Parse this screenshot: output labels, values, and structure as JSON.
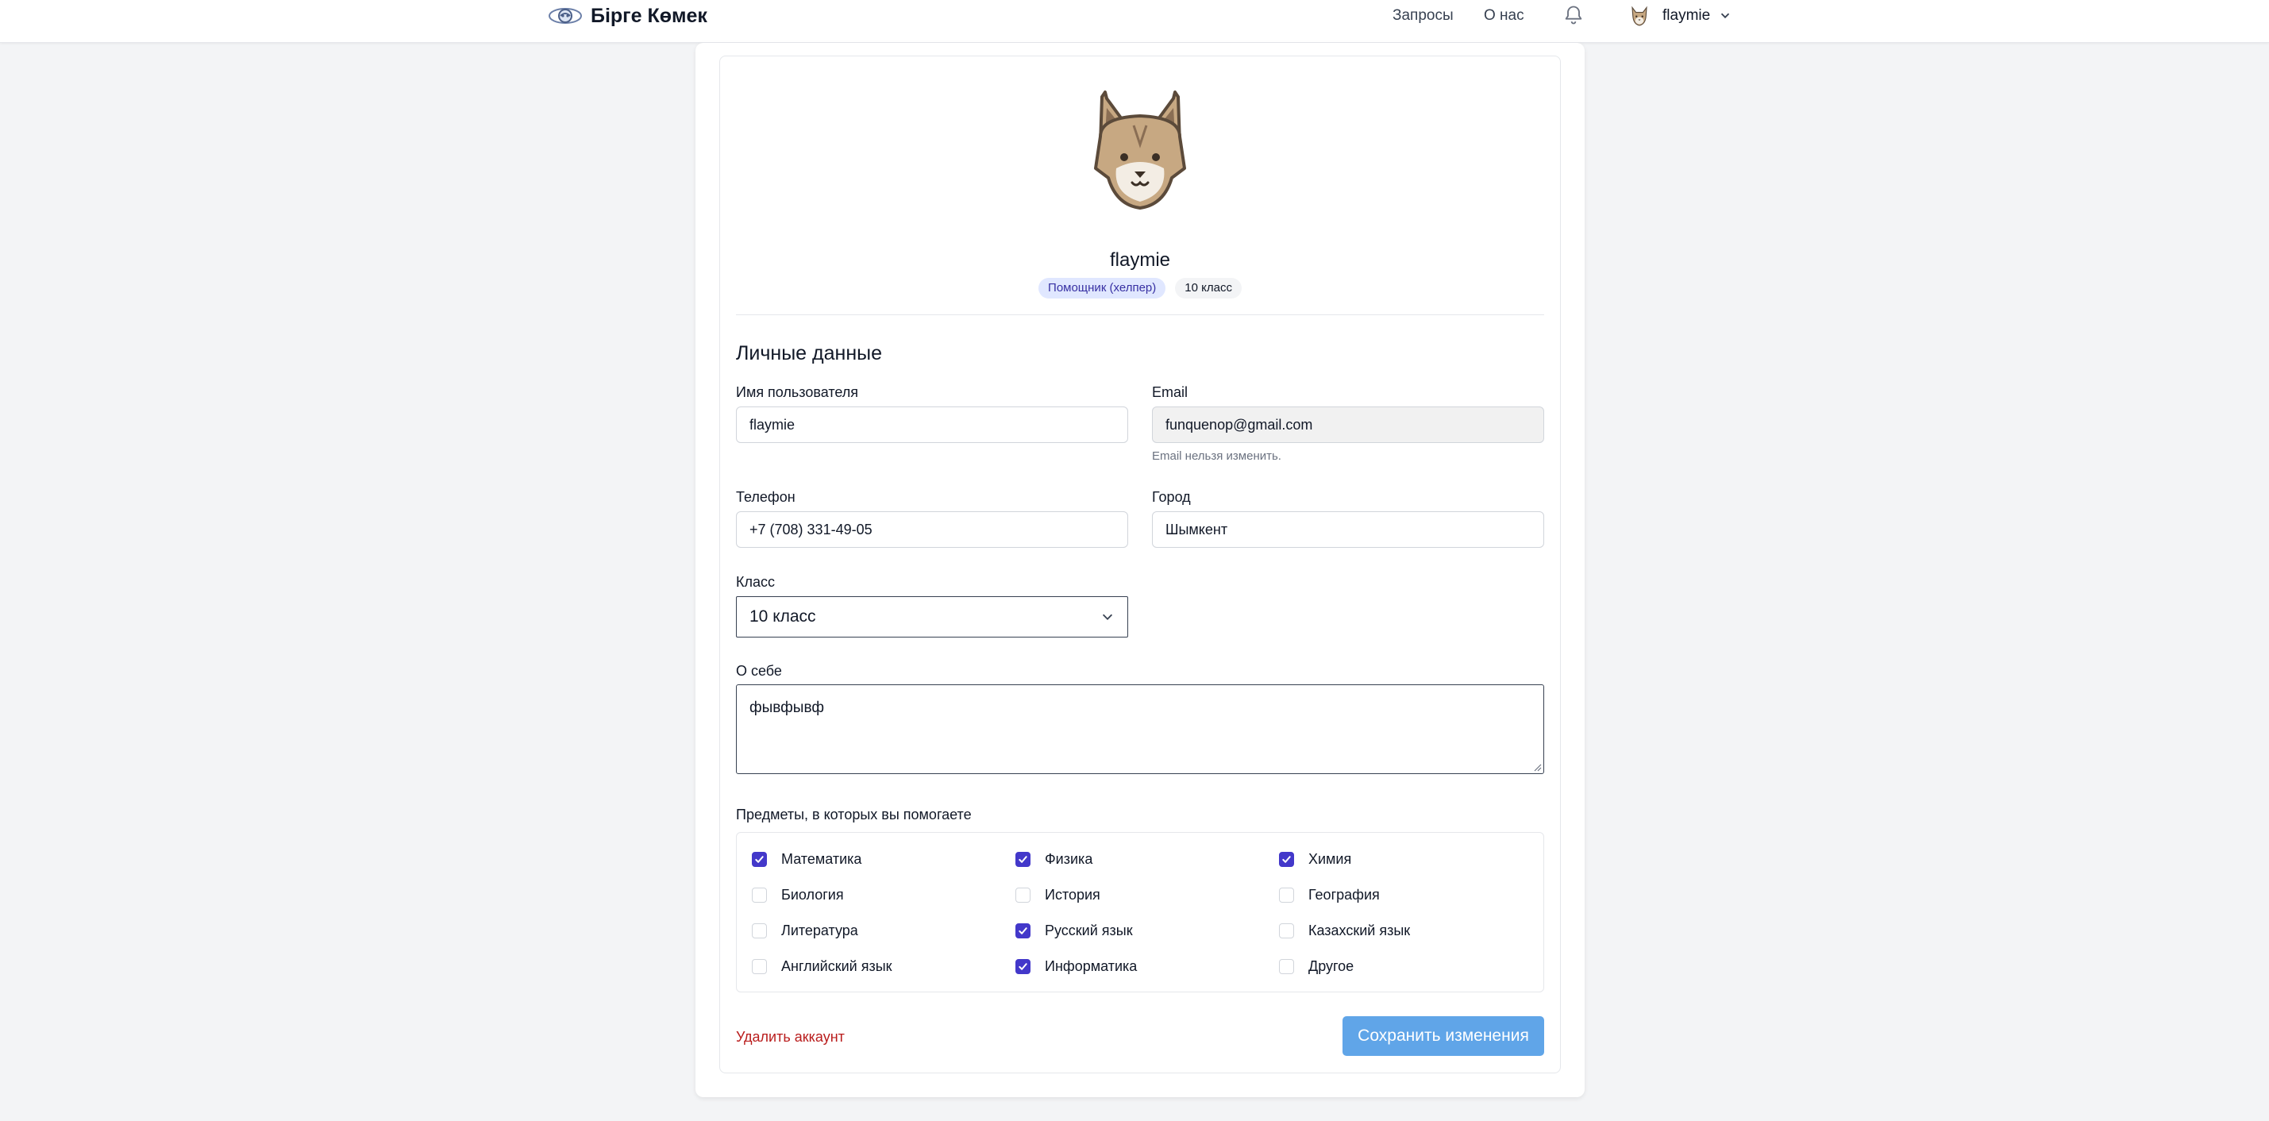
{
  "header": {
    "brand": "Бірге Көмек",
    "nav": {
      "requests": "Запросы",
      "about": "О нас"
    },
    "user": {
      "name": "flaymie"
    }
  },
  "profile": {
    "name": "flaymie",
    "role_badge": "Помощник (хелпер)",
    "grade_badge": "10 класс"
  },
  "form": {
    "section_title": "Личные данные",
    "username": {
      "label": "Имя пользователя",
      "value": "flaymie"
    },
    "email": {
      "label": "Email",
      "value": "funquenop@gmail.com",
      "hint": "Email нельзя изменить."
    },
    "phone": {
      "label": "Телефон",
      "value": "+7 (708) 331-49-05"
    },
    "city": {
      "label": "Город",
      "value": "Шымкент"
    },
    "grade": {
      "label": "Класс",
      "value": "10 класс"
    },
    "about": {
      "label": "О себе",
      "value": "фывфывф"
    },
    "subjects_label": "Предметы, в которых вы помогаете",
    "subjects": [
      {
        "label": "Математика",
        "checked": true
      },
      {
        "label": "Физика",
        "checked": true
      },
      {
        "label": "Химия",
        "checked": true
      },
      {
        "label": "Биология",
        "checked": false
      },
      {
        "label": "История",
        "checked": false
      },
      {
        "label": "География",
        "checked": false
      },
      {
        "label": "Литература",
        "checked": false
      },
      {
        "label": "Русский язык",
        "checked": true
      },
      {
        "label": "Казахский язык",
        "checked": false
      },
      {
        "label": "Английский язык",
        "checked": false
      },
      {
        "label": "Информатика",
        "checked": true
      },
      {
        "label": "Другое",
        "checked": false
      }
    ],
    "delete_label": "Удалить аккаунт",
    "save_label": "Сохранить изменения"
  },
  "colors": {
    "accent": "#4338ca",
    "save_button": "#60a5e8",
    "danger": "#b91c1c"
  },
  "icons": [
    "logo-icon",
    "bell-icon",
    "chevron-down-icon",
    "lynx-avatar-icon",
    "checkbox-check-icon"
  ]
}
